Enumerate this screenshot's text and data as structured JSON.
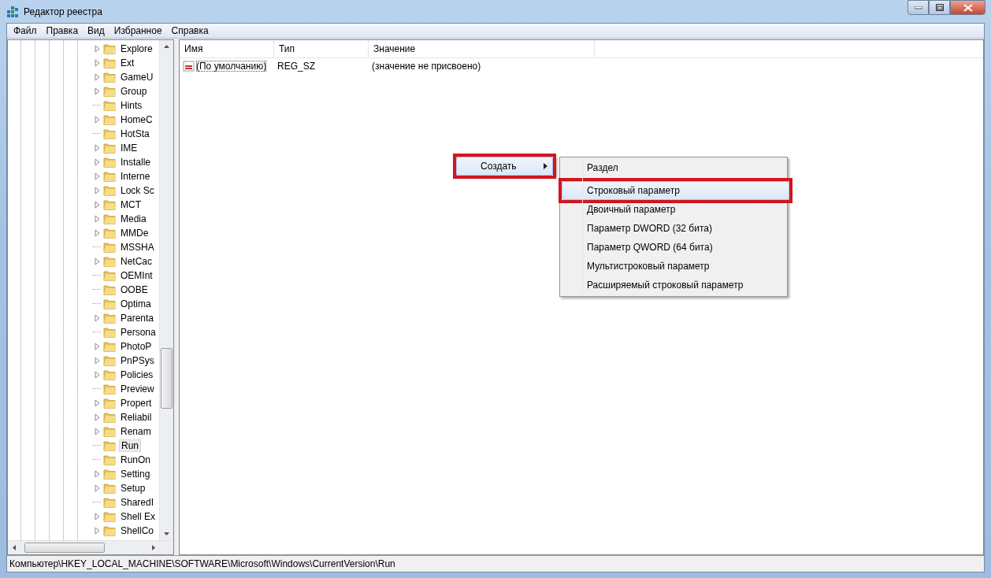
{
  "window": {
    "title": "Редактор реестра"
  },
  "menu_bar": [
    "Файл",
    "Правка",
    "Вид",
    "Избранное",
    "Справка"
  ],
  "tree": {
    "items": [
      {
        "label": "Explore",
        "expandable": true,
        "selected": false
      },
      {
        "label": "Ext",
        "expandable": true,
        "selected": false
      },
      {
        "label": "GameU",
        "expandable": true,
        "selected": false
      },
      {
        "label": "Group",
        "expandable": true,
        "selected": false
      },
      {
        "label": "Hints",
        "expandable": false,
        "selected": false
      },
      {
        "label": "HomeC",
        "expandable": true,
        "selected": false
      },
      {
        "label": "HotSta",
        "expandable": false,
        "selected": false
      },
      {
        "label": "IME",
        "expandable": true,
        "selected": false
      },
      {
        "label": "Installe",
        "expandable": true,
        "selected": false
      },
      {
        "label": "Interne",
        "expandable": true,
        "selected": false
      },
      {
        "label": "Lock Sc",
        "expandable": true,
        "selected": false
      },
      {
        "label": "MCT",
        "expandable": true,
        "selected": false
      },
      {
        "label": "Media",
        "expandable": true,
        "selected": false
      },
      {
        "label": "MMDe",
        "expandable": true,
        "selected": false
      },
      {
        "label": "MSSHA",
        "expandable": false,
        "selected": false
      },
      {
        "label": "NetCac",
        "expandable": true,
        "selected": false
      },
      {
        "label": "OEMInt",
        "expandable": false,
        "selected": false
      },
      {
        "label": "OOBE",
        "expandable": false,
        "selected": false
      },
      {
        "label": "Optima",
        "expandable": false,
        "selected": false
      },
      {
        "label": "Parenta",
        "expandable": true,
        "selected": false
      },
      {
        "label": "Persona",
        "expandable": false,
        "selected": false
      },
      {
        "label": "PhotoP",
        "expandable": true,
        "selected": false
      },
      {
        "label": "PnPSys",
        "expandable": true,
        "selected": false
      },
      {
        "label": "Policies",
        "expandable": true,
        "selected": false
      },
      {
        "label": "Preview",
        "expandable": false,
        "selected": false
      },
      {
        "label": "Propert",
        "expandable": true,
        "selected": false
      },
      {
        "label": "Reliabil",
        "expandable": true,
        "selected": false
      },
      {
        "label": "Renam",
        "expandable": true,
        "selected": false
      },
      {
        "label": "Run",
        "expandable": false,
        "selected": true
      },
      {
        "label": "RunOn",
        "expandable": false,
        "selected": false
      },
      {
        "label": "Setting",
        "expandable": true,
        "selected": false
      },
      {
        "label": "Setup",
        "expandable": true,
        "selected": false
      },
      {
        "label": "SharedI",
        "expandable": false,
        "selected": false
      },
      {
        "label": "Shell Ex",
        "expandable": true,
        "selected": false
      },
      {
        "label": "ShellCo",
        "expandable": true,
        "selected": false
      }
    ]
  },
  "values_table": {
    "columns": [
      "Имя",
      "Тип",
      "Значение"
    ],
    "rows": [
      {
        "name": "(По умолчанию)",
        "type": "REG_SZ",
        "value": "(значение не присвоено)",
        "focused": true
      }
    ]
  },
  "context_menu": {
    "items": [
      {
        "label": "Создать",
        "selected": true,
        "submenu": true,
        "marked": true
      }
    ]
  },
  "submenu": {
    "items": [
      {
        "label": "Раздел",
        "selected": false,
        "marked": false,
        "separator_after": true
      },
      {
        "label": "Строковый параметр",
        "selected": true,
        "marked": true,
        "separator_after": false
      },
      {
        "label": "Двоичный параметр",
        "selected": false,
        "marked": false,
        "separator_after": false
      },
      {
        "label": "Параметр DWORD (32 бита)",
        "selected": false,
        "marked": false,
        "separator_after": false
      },
      {
        "label": "Параметр QWORD (64 бита)",
        "selected": false,
        "marked": false,
        "separator_after": false
      },
      {
        "label": "Мультистроковый параметр",
        "selected": false,
        "marked": false,
        "separator_after": false
      },
      {
        "label": "Расширяемый строковый параметр",
        "selected": false,
        "marked": false,
        "separator_after": false
      }
    ]
  },
  "status_bar": {
    "path": "Компьютер\\HKEY_LOCAL_MACHINE\\SOFTWARE\\Microsoft\\Windows\\CurrentVersion\\Run"
  }
}
